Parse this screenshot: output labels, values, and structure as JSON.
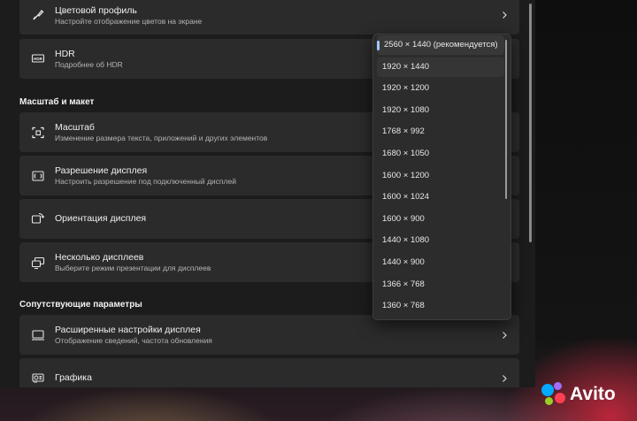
{
  "display_settings": {
    "color_profile": {
      "title": "Цветовой профиль",
      "subtitle": "Настройте отображение цветов на экране"
    },
    "hdr": {
      "title": "HDR",
      "subtitle": "Подробнее об HDR"
    },
    "scale_layout_heading": "Масштаб и макет",
    "scale": {
      "title": "Масштаб",
      "subtitle": "Изменение размера текста, приложений и других элементов"
    },
    "resolution": {
      "title": "Разрешение дисплея",
      "subtitle": "Настроить разрешение под подключенный дисплей"
    },
    "orientation": {
      "title": "Ориентация дисплея"
    },
    "multiple_displays": {
      "title": "Несколько дисплеев",
      "subtitle": "Выберите режим презентации для дисплеев"
    },
    "related_heading": "Сопутствующие параметры",
    "advanced": {
      "title": "Расширенные настройки дисплея",
      "subtitle": "Отображение сведений, частота обновления"
    },
    "graphics": {
      "title": "Графика"
    }
  },
  "resolution_dropdown": {
    "selected_index": 0,
    "options": [
      "2560 × 1440 (рекомендуется)",
      "1920 × 1440",
      "1920 × 1200",
      "1920 × 1080",
      "1768 × 992",
      "1680 × 1050",
      "1600 × 1200",
      "1600 × 1024",
      "1600 × 900",
      "1440 × 1080",
      "1440 × 900",
      "1366 × 768",
      "1360 × 768"
    ]
  },
  "watermark": {
    "text": "Avito"
  },
  "colors": {
    "accent": "#9fc7ff",
    "card_bg": "#2b2b2b",
    "window_bg": "#1c1c1c",
    "avito_dots": [
      "#00aaff",
      "#a16eff",
      "#97cf26",
      "#ff4053"
    ]
  }
}
